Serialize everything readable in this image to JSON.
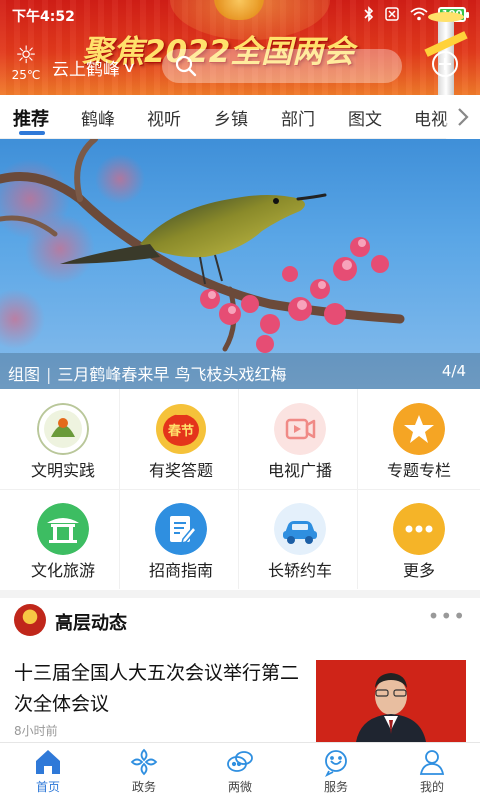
{
  "status_bar": {
    "time": "下午4:52",
    "battery": "100"
  },
  "header": {
    "banner_text": "聚焦2022全国两会",
    "weather": {
      "icon": "sun-icon",
      "temperature": "25℃"
    },
    "location": "云上鹤峰",
    "search": {
      "placeholder": ""
    }
  },
  "tabs": [
    {
      "label": "推荐",
      "active": true
    },
    {
      "label": "鹤峰"
    },
    {
      "label": "视听"
    },
    {
      "label": "乡镇"
    },
    {
      "label": "部门"
    },
    {
      "label": "图文"
    },
    {
      "label": "电视"
    }
  ],
  "hero": {
    "caption_tag": "组图",
    "caption": "三月鹤峰春来早 鸟飞枝头戏红梅",
    "counter": "4/4"
  },
  "functions": [
    {
      "label": "文明实践",
      "icon": "civilization-practice-icon",
      "color": "#6a9a3a"
    },
    {
      "label": "有奖答题",
      "icon": "spring-festival-lantern-icon",
      "color": "#e4341b"
    },
    {
      "label": "电视广播",
      "icon": "tv-broadcast-icon",
      "color": "#f0b5b2"
    },
    {
      "label": "专题专栏",
      "icon": "star-icon",
      "color": "#f5a524"
    },
    {
      "label": "文化旅游",
      "icon": "pavilion-icon",
      "color": "#3dbd62"
    },
    {
      "label": "招商指南",
      "icon": "document-edit-icon",
      "color": "#2f8fe0"
    },
    {
      "label": "长轿约车",
      "icon": "car-icon",
      "color": "#2f8fe0"
    },
    {
      "label": "更多",
      "icon": "more-icon",
      "color": "#f5b428"
    }
  ],
  "section": {
    "title": "高层动态",
    "more": "•••"
  },
  "news": [
    {
      "headline": "十三届全国人大五次会议举行第二次全体会议",
      "time": "8小时前"
    }
  ],
  "bottom_nav": [
    {
      "label": "首页",
      "icon": "home-icon",
      "active": true
    },
    {
      "label": "政务",
      "icon": "government-icon"
    },
    {
      "label": "两微",
      "icon": "weibo-weixin-icon"
    },
    {
      "label": "服务",
      "icon": "service-icon"
    },
    {
      "label": "我的",
      "icon": "profile-icon"
    }
  ],
  "colors": {
    "accent": "#2f79d8",
    "header_red": "#d21e16",
    "banner_gold": "#ffe16b"
  }
}
